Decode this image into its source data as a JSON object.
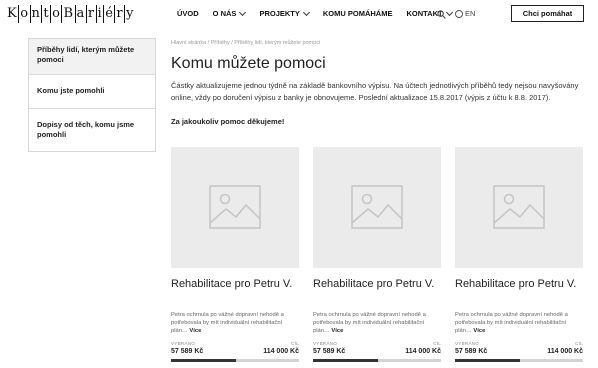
{
  "header": {
    "logo_cells": [
      "K",
      "o",
      "n",
      "t",
      "o",
      "B",
      "a",
      "r",
      "i",
      "é",
      "r",
      "y"
    ],
    "nav": [
      {
        "label": "ÚVOD",
        "dropdown": false
      },
      {
        "label": "O NÁS",
        "dropdown": true
      },
      {
        "label": "PROJEKTY",
        "dropdown": true
      },
      {
        "label": "KOMU POMÁHÁME",
        "dropdown": false
      },
      {
        "label": "KONTAKT",
        "dropdown": true
      }
    ],
    "lang": "EN",
    "cta": "Chci pomáhat"
  },
  "sidebar": {
    "items": [
      {
        "label": "Příběhy lidí, kterým můžete pomoci",
        "active": true
      },
      {
        "label": "Komu jste pomohli",
        "active": false
      },
      {
        "label": "Dopisy od těch, komu jsme pomohli",
        "active": false
      }
    ]
  },
  "main": {
    "breadcrumb": "Hlavní stránka / Příběhy / Příběhy lidí, kterým můžete pomoci",
    "title": "Komu můžete pomoci",
    "intro": "Částky aktualizujeme jednou týdně na základě bankovního výpisu. Na účtech jednotlivých příběhů tedy nejsou navyšovány online, vždy po doručení výpisu z banky je obnovujeme. Poslední aktualizace 15.8.2017 (výpis z účtu k 8.8. 2017).",
    "thanks": "Za jakoukoliv pomoc děkujeme!"
  },
  "cards": [
    {
      "title": "Rehabilitace pro Petru V.",
      "desc": "Petra ochrnula po vážné dopravní nehodě a potřebovala by mít individuální rehabilitační plán…",
      "more": "Více",
      "raised_label": "VYBRÁNO",
      "goal_label": "CÍL",
      "raised": "57 589 Kč",
      "goal": "114 000 Kč",
      "progress": 0.505
    },
    {
      "title": "Rehabilitace pro Petru V.",
      "desc": "Petra ochrnula po vážné dopravní nehodě a potřebovala by mít individuální rehabilitační plán…",
      "more": "Více",
      "raised_label": "VYBRÁNO",
      "goal_label": "CÍL",
      "raised": "57 589 Kč",
      "goal": "114 000 Kč",
      "progress": 0.505
    },
    {
      "title": "Rehabilitace pro Petru V.",
      "desc": "Petra ochrnula po vážné dopravní nehodě a potřebovala by mít individuální rehabilitační plán…",
      "more": "Více",
      "raised_label": "VYBRÁNO",
      "goal_label": "CÍL",
      "raised": "57 589 Kč",
      "goal": "114 000 Kč",
      "progress": 0.505
    }
  ]
}
